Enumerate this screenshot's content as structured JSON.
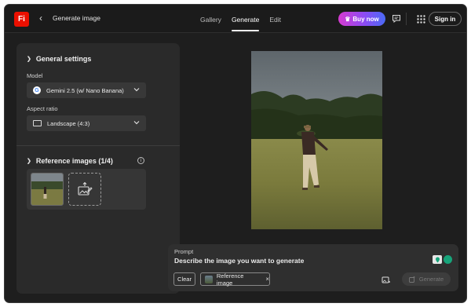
{
  "app": {
    "logo_text": "Fi",
    "title": "Generate image"
  },
  "nav": {
    "tabs": [
      {
        "label": "Gallery"
      },
      {
        "label": "Generate"
      },
      {
        "label": "Edit"
      }
    ],
    "active": "Generate"
  },
  "header": {
    "buy_now": "Buy now",
    "sign_in": "Sign in"
  },
  "settings": {
    "title": "General settings",
    "model_label": "Model",
    "model_value": "Gemini 2.5 (w/ Nano Banana)",
    "aspect_label": "Aspect ratio",
    "aspect_value": "Landscape (4:3)"
  },
  "reference": {
    "title": "Reference images (1/4)"
  },
  "prompt": {
    "label": "Prompt",
    "placeholder": "Describe the image you want to generate",
    "clear": "Clear",
    "chip": "Reference image",
    "generate": "Generate"
  },
  "colors": {
    "accent_gradient": [
      "#d63bd0",
      "#4a6af5"
    ],
    "logo": "#eb1000",
    "surface": "#1e1e1e"
  }
}
